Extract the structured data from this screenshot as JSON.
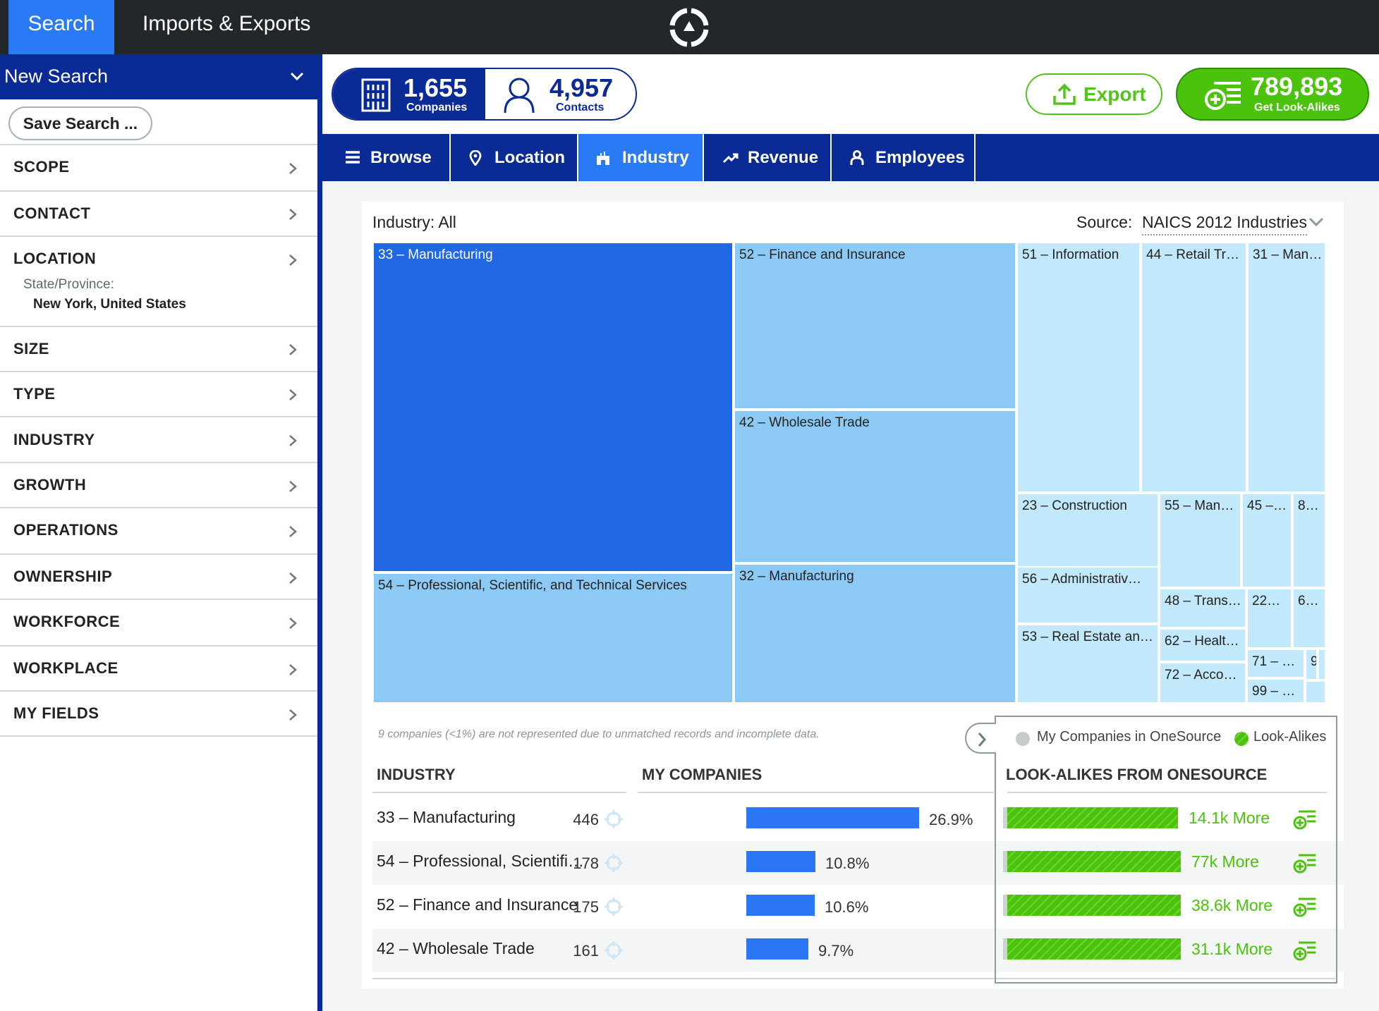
{
  "topbar": {
    "tabs": [
      {
        "label": "Search",
        "active": true
      },
      {
        "label": "Imports & Exports",
        "active": false
      }
    ],
    "logo_icon": "target-logo-icon"
  },
  "sidebar": {
    "header": "New Search",
    "save_label": "Save Search ...",
    "items": [
      {
        "label": "SCOPE"
      },
      {
        "label": "CONTACT"
      },
      {
        "label": "LOCATION",
        "sub_label": "State/Province:",
        "sub_value": "New York, United States"
      },
      {
        "label": "SIZE"
      },
      {
        "label": "TYPE"
      },
      {
        "label": "INDUSTRY"
      },
      {
        "label": "GROWTH"
      },
      {
        "label": "OPERATIONS"
      },
      {
        "label": "OWNERSHIP"
      },
      {
        "label": "WORKFORCE"
      },
      {
        "label": "WORKPLACE"
      },
      {
        "label": "MY FIELDS"
      }
    ]
  },
  "header": {
    "companies_count": "1,655",
    "companies_label": "Companies",
    "contacts_count": "4,957",
    "contacts_label": "Contacts",
    "export_label": "Export",
    "lookalikes_count": "789,893",
    "lookalikes_label": "Get Look-Alikes"
  },
  "tabs": [
    {
      "label": "Browse",
      "icon": "menu-icon",
      "active": false
    },
    {
      "label": "Location",
      "icon": "map-pin-icon",
      "active": false
    },
    {
      "label": "Industry",
      "icon": "factory-icon",
      "active": true
    },
    {
      "label": "Revenue",
      "icon": "trend-up-icon",
      "active": false
    },
    {
      "label": "Employees",
      "icon": "person-icon",
      "active": false
    }
  ],
  "panel": {
    "industry_filter": "Industry: All",
    "source_label": "Source:",
    "source_value": "NAICS 2012 Industries",
    "note": "9 companies (<1%) are not represented due to unmatched records and incomplete data.",
    "colors": {
      "highlight": "#2068e4",
      "mid": "#8ccaf5",
      "light": "#c2e8fb",
      "bar": "#2b76f5",
      "green": "#4bc20b"
    }
  },
  "chart_data": {
    "type": "treemap",
    "title": "Industry: All",
    "cells": [
      {
        "label": "33 – Manufacturing",
        "shade": "highlight"
      },
      {
        "label": "54 – Professional, Scientific, and Technical Services",
        "shade": "mid"
      },
      {
        "label": "52 – Finance and Insurance",
        "shade": "mid"
      },
      {
        "label": "42 – Wholesale Trade",
        "shade": "mid"
      },
      {
        "label": "32 – Manufacturing",
        "shade": "mid"
      },
      {
        "label": "51 – Information",
        "shade": "light"
      },
      {
        "label": "44 – Retail Tr…",
        "shade": "light"
      },
      {
        "label": "31 – Man…",
        "shade": "light"
      },
      {
        "label": "23 – Construction",
        "shade": "light"
      },
      {
        "label": "56 – Administrativ…",
        "shade": "light"
      },
      {
        "label": "53 – Real Estate an…",
        "shade": "light"
      },
      {
        "label": "55 – Man…",
        "shade": "light"
      },
      {
        "label": "45 –…",
        "shade": "light"
      },
      {
        "label": "8…",
        "shade": "light"
      },
      {
        "label": "48 – Trans…",
        "shade": "light"
      },
      {
        "label": "22…",
        "shade": "light"
      },
      {
        "label": "6…",
        "shade": "light"
      },
      {
        "label": "62 – Healt…",
        "shade": "light"
      },
      {
        "label": "72 – Acco…",
        "shade": "light"
      },
      {
        "label": "71 – …",
        "shade": "light"
      },
      {
        "label": "99 – …",
        "shade": "light"
      },
      {
        "label": "9",
        "shade": "light"
      },
      {
        "label": "",
        "shade": "light"
      },
      {
        "label": "",
        "shade": "light"
      }
    ]
  },
  "table": {
    "industry_header": "INDUSTRY",
    "mycompanies_header": "MY COMPANIES",
    "lookalikes_header": "LOOK-ALIKES FROM ONESOURCE",
    "legend": [
      {
        "label": "My Companies in OneSource",
        "color": "#c5cccc"
      },
      {
        "label": "Look-Alikes",
        "color": "#4bc20b"
      }
    ],
    "rows": [
      {
        "industry": "33 – Manufacturing",
        "count": "446",
        "percent": "26.9%",
        "share": 26.9,
        "lookalikes": "14.1k More"
      },
      {
        "industry": "54 – Professional, Scientifi…",
        "count": "178",
        "percent": "10.8%",
        "share": 10.8,
        "lookalikes": "77k More"
      },
      {
        "industry": "52 – Finance and Insurance",
        "count": "175",
        "percent": "10.6%",
        "share": 10.6,
        "lookalikes": "38.6k More"
      },
      {
        "industry": "42 – Wholesale Trade",
        "count": "161",
        "percent": "9.7%",
        "share": 9.7,
        "lookalikes": "31.1k More"
      }
    ]
  }
}
